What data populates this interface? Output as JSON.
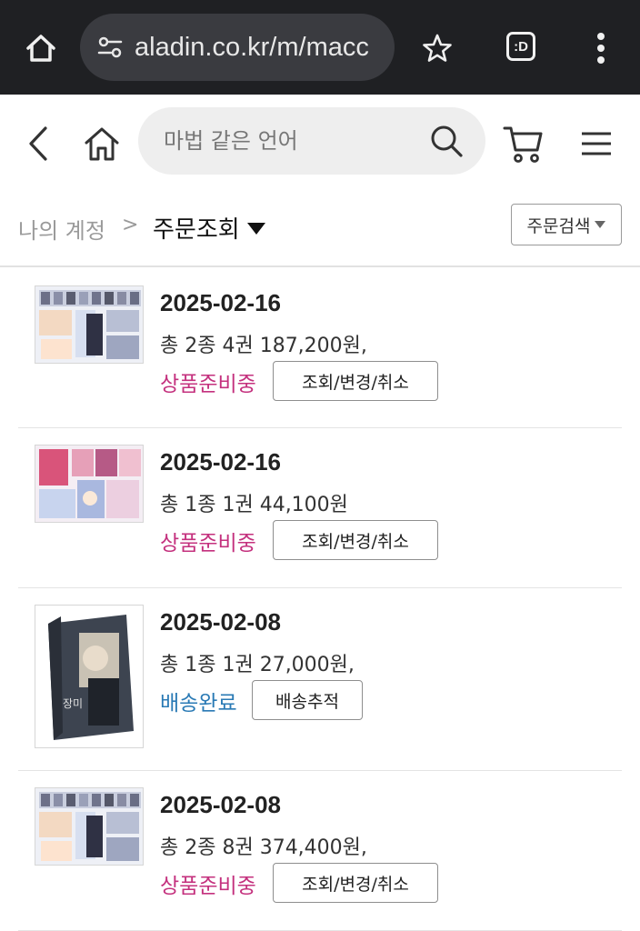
{
  "browser": {
    "url": "aladin.co.kr/m/macc",
    "tab_count": ":D",
    "icons": [
      "home-icon",
      "site-settings-icon",
      "star-icon",
      "tabs-icon",
      "more-vert-icon"
    ]
  },
  "header": {
    "search_placeholder": "마법 같은 언어",
    "icons": [
      "back-icon",
      "home-icon",
      "search-icon",
      "cart-icon",
      "menu-icon"
    ]
  },
  "breadcrumb": {
    "parent": "나의 계정",
    "separator": ">",
    "current": "주문조회",
    "order_search_label": "주문검색"
  },
  "colors": {
    "status_preparing": "#c4317e",
    "status_delivered": "#2a7ab5",
    "chrome_bg": "#1f2023"
  },
  "orders": [
    {
      "date": "2025-02-16",
      "summary": "총 2종 4권 187,200원,",
      "status": "상품준비중",
      "status_type": "preparing",
      "action": "조회/변경/취소"
    },
    {
      "date": "2025-02-16",
      "summary": "총 1종 1권 44,100원",
      "status": "상품준비중",
      "status_type": "preparing",
      "action": "조회/변경/취소"
    },
    {
      "date": "2025-02-08",
      "summary": "총 1종 1권 27,000원,",
      "status": "배송완료",
      "status_type": "delivered",
      "action": "배송추적"
    },
    {
      "date": "2025-02-08",
      "summary": "총 2종 8권 374,400원,",
      "status": "상품준비중",
      "status_type": "preparing",
      "action": "조회/변경/취소"
    }
  ]
}
